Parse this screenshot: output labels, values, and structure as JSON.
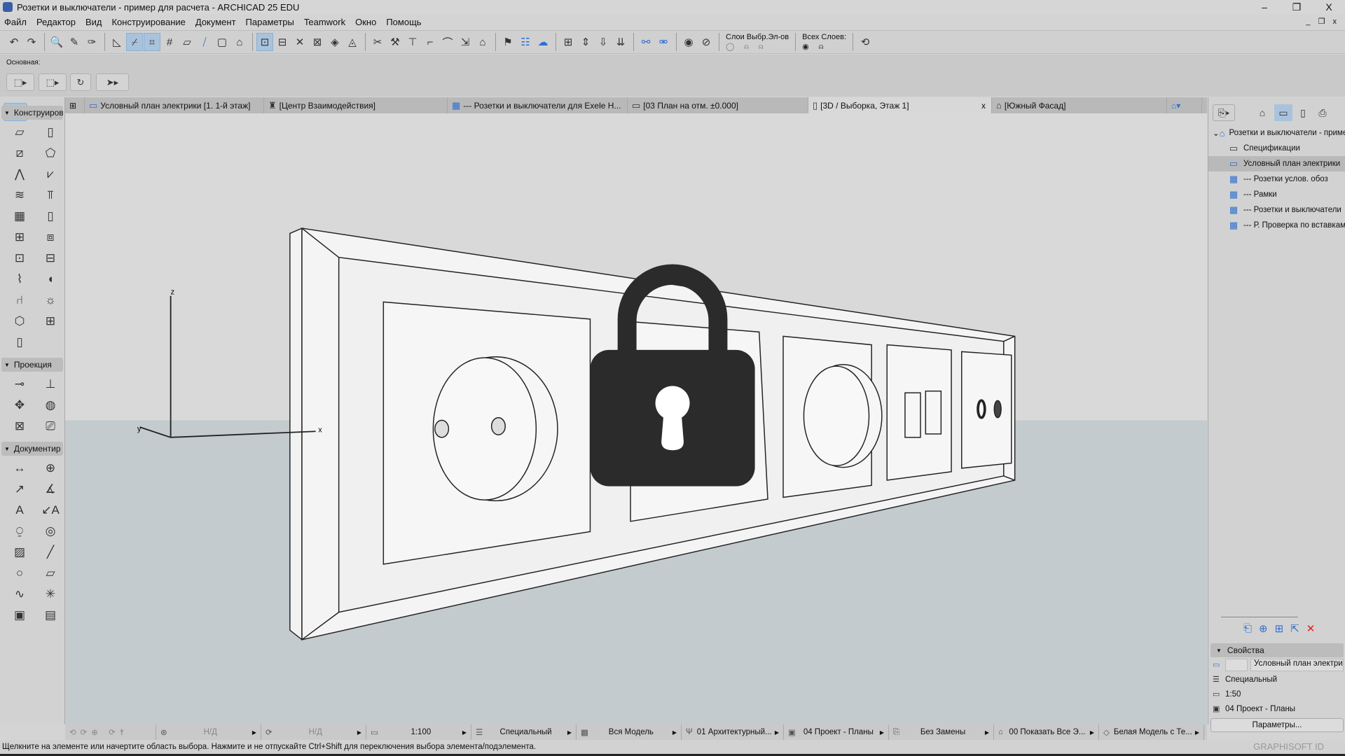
{
  "window": {
    "title": "Розетки и выключатели - пример для расчета - ARCHICAD 25 EDU",
    "minimize": "–",
    "restore": "❐",
    "close": "X",
    "doc_controls": "_ ❐ x"
  },
  "menu": [
    "Файл",
    "Редактор",
    "Вид",
    "Конструирование",
    "Документ",
    "Параметры",
    "Teamwork",
    "Окно",
    "Помощь"
  ],
  "toolbar": {
    "icons": [
      "undo-icon",
      "redo-icon",
      "|",
      "find-select-icon",
      "pick-up-icon",
      "inject-icon",
      "|",
      "guide-line-icon",
      "snap-guide-icon",
      "coordinate-icon",
      "grid-snap-icon",
      "surface-icon",
      "trace-icon",
      "layer-icon",
      "lock-icon",
      "|",
      "suspend-groups-icon",
      "ruler-icon",
      "cross-icon",
      "element-info-icon",
      "view-icon",
      "cone-icon",
      "|",
      "scissors-icon",
      "hammer-icon",
      "elevate-icon",
      "fillet-icon",
      "curve-icon",
      "resize-icon",
      "roof-icon",
      "|",
      "flag-icon",
      "schedule-icon",
      "cloud-icon",
      "|",
      "floor-icon",
      "section-icon",
      "hotlink-icon",
      "merge-icon",
      "|",
      "link-icon",
      "unlink-icon",
      "|",
      "eye-icon",
      "lock-layers-icon"
    ],
    "layers_label": "Слои Выбр.Эл-ов",
    "all_layers_label": "Всех Слоев:"
  },
  "infobox": {
    "label": "Основная:"
  },
  "tabs": [
    {
      "label": "Условный план электрики [1. 1-й этаж]",
      "icon": "floorplan-icon"
    },
    {
      "label": "[Центр Взаимодействия]",
      "icon": "lighthouse-icon"
    },
    {
      "label": "--- Розетки и выключатели для Exele H...",
      "icon": "schedule-icon"
    },
    {
      "label": "[03 План на отм. ±0.000]",
      "icon": "layout-icon"
    },
    {
      "label": "[3D / Выборка, Этаж 1]",
      "icon": "3d-icon",
      "active": true,
      "close": "x"
    },
    {
      "label": "[Южный Фасад]",
      "icon": "elevation-icon"
    }
  ],
  "toolbox": {
    "groups": [
      {
        "label": "Конструиров",
        "tools": [
          "wall",
          "column",
          "beam",
          "slab",
          "roof",
          "shell",
          "stair",
          "railing",
          "curtain-wall",
          "door",
          "window",
          "skylight",
          "opening",
          "object",
          "mesh",
          "morph",
          "chair",
          "lamp",
          "zone",
          "curtain-panel",
          "skylight2"
        ]
      },
      {
        "label": "Проекция",
        "tools": [
          "section",
          "elevation",
          "interior-elevation",
          "worksheet",
          "detail",
          "camera"
        ]
      },
      {
        "label": "Документир",
        "tools": [
          "dimension",
          "level-dimension",
          "radial-dimension",
          "angle-dimension",
          "text",
          "label",
          "spot",
          "change",
          "fill",
          "line",
          "circle",
          "polyline",
          "spline",
          "hotspot",
          "figure",
          "drawing"
        ]
      }
    ]
  },
  "viewport": {
    "axis_x": "x",
    "axis_y": "y",
    "axis_z": "z",
    "sky": "#d9d9d9",
    "ground": "#c4cbcf",
    "lock_color": "#2b2b2b"
  },
  "navigator": {
    "items": [
      {
        "label": "Розетки и выключатели - пример для расчета",
        "icon": "project-icon",
        "level": 0
      },
      {
        "label": "Спецификации",
        "icon": "folder-icon",
        "level": 1
      },
      {
        "label": "Условный план электрики",
        "icon": "floorplan-icon",
        "level": 1,
        "selected": true
      },
      {
        "label": "--- Розетки услов. обоз",
        "icon": "schedule-icon",
        "level": 2
      },
      {
        "label": "--- Рамки",
        "icon": "schedule-icon",
        "level": 2
      },
      {
        "label": "--- Розетки и выключатели",
        "icon": "schedule-icon",
        "level": 2
      },
      {
        "label": "--- Р. Проверка по вставкам",
        "icon": "schedule-icon",
        "level": 2
      }
    ]
  },
  "properties": {
    "title": "Свойства",
    "name_value": "Условный план электри",
    "layer_combo": "Специальный",
    "scale": "1:50",
    "penset": "04 Проект - Планы",
    "settings_button": "Параметры..."
  },
  "statusbar": [
    {
      "icon": "zoom-icon",
      "value": "Н/Д"
    },
    {
      "icon": "rotate-icon",
      "value": "Н/Д"
    },
    {
      "icon": "scale-icon",
      "value": "1:100"
    },
    {
      "icon": "layers-icon",
      "value": "Специальный"
    },
    {
      "icon": "model-icon",
      "value": "Вся Модель"
    },
    {
      "icon": "pen-icon",
      "value": "01 Архитектурный..."
    },
    {
      "icon": "penset-icon",
      "value": "04 Проект - Планы"
    },
    {
      "icon": "override-icon",
      "value": "Без Замены"
    },
    {
      "icon": "renovation-icon",
      "value": "00 Показать Все Э..."
    },
    {
      "icon": "3d-style-icon",
      "value": "Белая Модель с Те..."
    }
  ],
  "message": "Щелкните на элементе или начертите область выбора. Нажмите и не отпускайте Ctrl+Shift для переключения выбора элемента/подэлемента.",
  "graphisoft_id": "GRAPHISOFT ID"
}
